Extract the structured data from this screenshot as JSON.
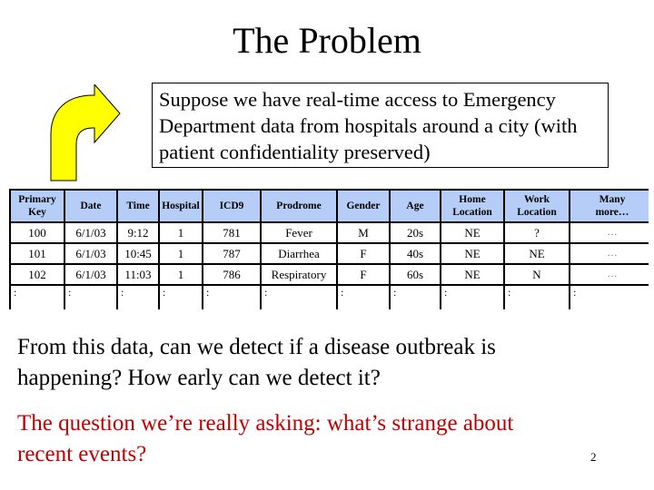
{
  "slide": {
    "title": "The Problem",
    "callout_text": [
      "Suppose we have real-time access to Emergency",
      "Department data from hospitals around a city (with",
      "patient confidentiality preserved)"
    ],
    "body_text": [
      "From this data, can we detect if a disease outbreak is",
      "happening?  How early can we detect it?"
    ],
    "question_text": [
      "The question we’re really asking: what’s strange about",
      "recent events?"
    ],
    "page_number": "2",
    "colors": {
      "header_fill": "#b6cef7",
      "arrow_fill": "#ffff00",
      "question_color": "#c00000"
    }
  },
  "table": {
    "headers": [
      [
        "Primary",
        "Key"
      ],
      [
        "Date"
      ],
      [
        "Time"
      ],
      [
        "Hospital"
      ],
      [
        "ICD9"
      ],
      [
        "Prodrome"
      ],
      [
        "Gender"
      ],
      [
        "Age"
      ],
      [
        "Home",
        "Location"
      ],
      [
        "Work",
        "Location"
      ],
      [
        "Many",
        "more…"
      ]
    ],
    "rows": [
      [
        "100",
        "6/1/03",
        "9:12",
        "1",
        "781",
        "Fever",
        "M",
        "20s",
        "NE",
        "?",
        "…"
      ],
      [
        "101",
        "6/1/03",
        "10:45",
        "1",
        "787",
        "Diarrhea",
        "F",
        "40s",
        "NE",
        "NE",
        "…"
      ],
      [
        "102",
        "6/1/03",
        "11:03",
        "1",
        "786",
        "Respiratory",
        "F",
        "60s",
        "NE",
        "N",
        "…"
      ]
    ],
    "continuation_mark": ":"
  }
}
